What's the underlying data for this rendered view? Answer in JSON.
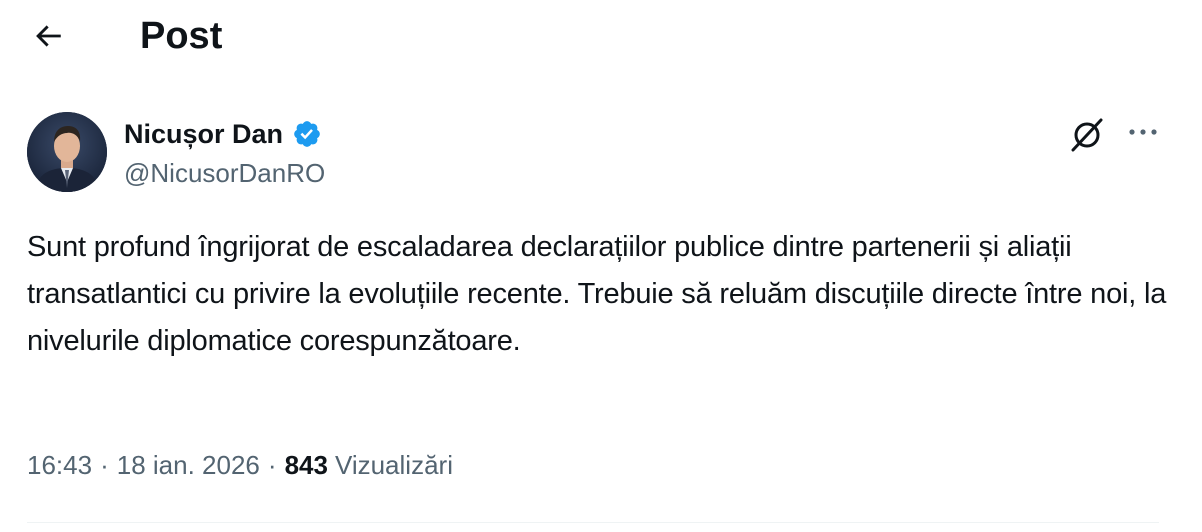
{
  "header": {
    "title": "Post",
    "back_icon": "arrow-left-icon"
  },
  "tweet": {
    "author": {
      "name": "Nicușor Dan",
      "handle": "@NicusorDanRO",
      "verified": true,
      "verified_color": "#1d9bf0"
    },
    "text": "Sunt profund îngrijorat de escaladarea declarațiilor publice dintre partenerii și aliații transatlantici cu privire la evoluțiile recente. Trebuie să reluăm discuțiile directe între noi, la nivelurile diplomatice corespunzătoare.",
    "time": "16:43",
    "separator": "·",
    "date": "18 ian. 2026",
    "views_count": "843",
    "views_label": "Vizualizări",
    "actions": {
      "grok_icon": "grok-icon",
      "more_icon": "more-icon"
    }
  },
  "colors": {
    "text_primary": "#0f1419",
    "text_secondary": "#536471",
    "divider": "#eff3f4"
  }
}
